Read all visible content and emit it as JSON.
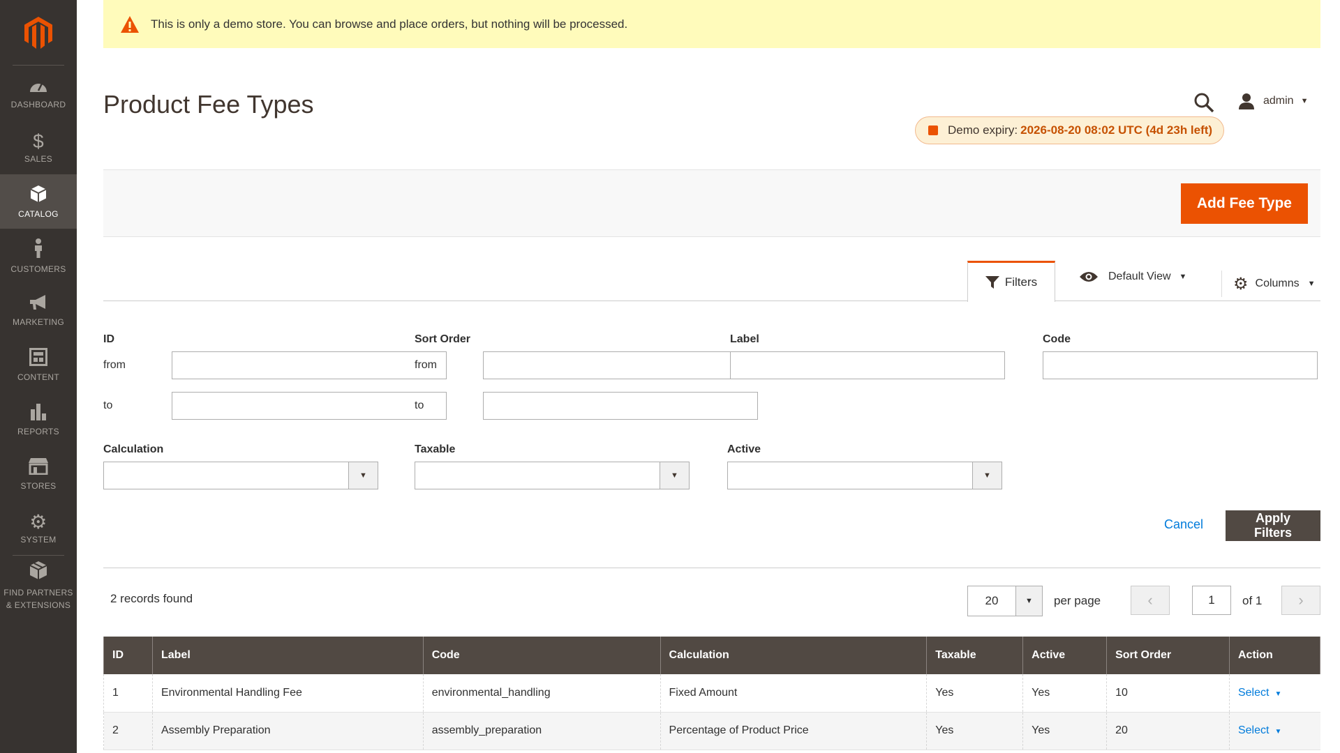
{
  "sidebar": {
    "logo_icon": "magento-logo-icon",
    "items": [
      {
        "label": "DASHBOARD",
        "icon": "dashboard-icon"
      },
      {
        "label": "SALES",
        "icon": "dollar-icon"
      },
      {
        "label": "CATALOG",
        "icon": "cube-icon",
        "active": true
      },
      {
        "label": "CUSTOMERS",
        "icon": "person-icon"
      },
      {
        "label": "MARKETING",
        "icon": "megaphone-icon"
      },
      {
        "label": "CONTENT",
        "icon": "layout-icon"
      },
      {
        "label": "REPORTS",
        "icon": "bar-chart-icon"
      },
      {
        "label": "STORES",
        "icon": "storefront-icon"
      },
      {
        "label": "SYSTEM",
        "icon": "gear-icon"
      },
      {
        "label": "FIND PARTNERS & EXTENSIONS",
        "icon": "boxes-icon"
      }
    ]
  },
  "banner": {
    "text": "This is only a demo store. You can browse and place orders, but nothing will be processed.",
    "icon": "warning-icon"
  },
  "header": {
    "title": "Product Fee Types",
    "user": "admin",
    "expiry_label": "Demo expiry:",
    "expiry_value": "2026-08-20 08:02 UTC (4d 23h left)"
  },
  "actions": {
    "add_label": "Add Fee Type"
  },
  "grid_controls": {
    "filters_label": "Filters",
    "view_label": "Default View",
    "columns_label": "Columns"
  },
  "filters": {
    "id_label": "ID",
    "sort_order_label": "Sort Order",
    "label_label": "Label",
    "code_label": "Code",
    "from": "from",
    "to": "to",
    "calculation_label": "Calculation",
    "taxable_label": "Taxable",
    "active_label": "Active",
    "cancel_label": "Cancel",
    "apply_label": "Apply Filters"
  },
  "records": {
    "count_text": "2 records found",
    "per_page_value": "20",
    "per_page_label": "per page",
    "page_value": "1",
    "of_text": "of 1"
  },
  "table": {
    "headers": [
      "ID",
      "Label",
      "Code",
      "Calculation",
      "Taxable",
      "Active",
      "Sort Order",
      "Action"
    ],
    "rows": [
      {
        "id": "1",
        "label": "Environmental Handling Fee",
        "code": "environmental_handling",
        "calculation": "Fixed Amount",
        "taxable": "Yes",
        "active": "Yes",
        "sort_order": "10",
        "action": "Select"
      },
      {
        "id": "2",
        "label": "Assembly Preparation",
        "code": "assembly_preparation",
        "calculation": "Percentage of Product Price",
        "taxable": "Yes",
        "active": "Yes",
        "sort_order": "20",
        "action": "Select"
      }
    ]
  },
  "colors": {
    "accent": "#eb5202",
    "sidebar_bg": "#373330",
    "header_bg": "#514943",
    "link": "#007bdb"
  }
}
